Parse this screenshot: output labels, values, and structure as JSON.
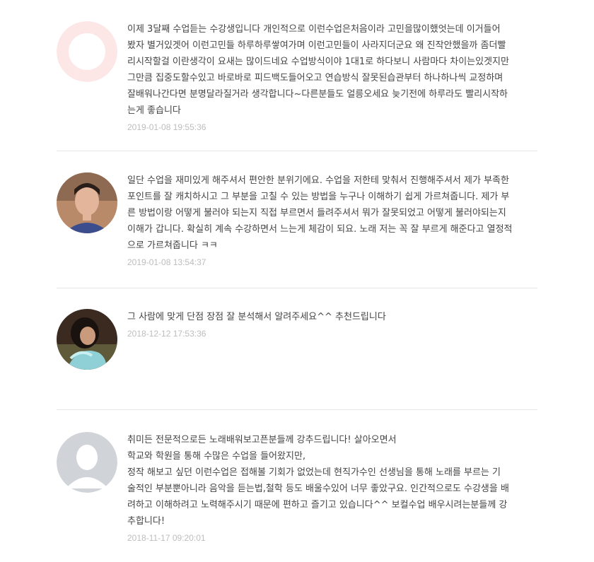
{
  "reviews": [
    {
      "avatar": "default-avatar-pink-icon",
      "lines": [
        "이제 3달째 수업듣는 수강생입니다 개인적으로 이런수업은처음이라 고민을많이했엇는데 이거들어",
        "봤자 별거있겟어 이런고민들 하루하루쌓여가며 이런고민들이 사라지더군요 왜 진작안했을까 좀더빨",
        "리시작할걸 이란생각이 요새는 많이드네요 수업방식이야 1대1로 하다보니 사람마다 차이는있겟지만",
        "그만큼 집중도할수있고 바로바로 피드백도들어오고 연습방식 잘못된습관부터 하나하나씩 교정하며",
        "잘배워나간다면 분명달라질거라 생각합니다~다른분들도 얼릉오세요 늦기전에 하루라도 빨리시작하",
        "는게 좋습니다"
      ],
      "date": "2019-01-08 19:55:36"
    },
    {
      "avatar": "user-photo-young-man",
      "lines": [
        "일단 수업을 재미있게 해주셔서 편안한 분위기에요. 수업을 저한테 맞춰서 진행해주셔서 제가 부족한",
        "포인트를 잘 캐치하시고 그 부분을 고칠 수 있는 방법을 누구나 이해하기 쉽게 가르쳐줍니다. 제가 부",
        "른 방법이랑 어떻게 불러야 되는지 직접 부르면서 들려주셔서 뭐가 잘못되었고 어떻게 불러야되는지",
        "이해가 갑니다. 확실히 계속 수강하면서 느는게 체감이 되요. 노래 저는 꼭 잘 부르게 해준다고 열정적",
        "으로 가르쳐줍니다 ㅋㅋ"
      ],
      "date": "2019-01-08 13:54:37"
    },
    {
      "avatar": "user-photo-woman",
      "lines": [
        "그 사람에 맞게 단점 장점 잘 분석해서 알려주세요^^ 추천드립니다"
      ],
      "date": "2018-12-12 17:53:36"
    },
    {
      "avatar": "default-avatar-gray-icon",
      "lines": [
        "취미든 전문적으로든 노래배워보고픈분들께 강추드립니다! 살아오면서",
        "학교와 학원을 통해 수많은 수업을 들어왔지만,",
        "정작 해보고 싶던 이런수업은 접해볼 기회가 없었는데 현직가수인 선생님을 통해 노래를 부르는 기",
        "술적인 부분뿐아니라 음악을 듣는법,철학 등도 배울수있어 너무 좋았구요. 인간적으로도 수강생을 배",
        "려하고 이해하려고 노력해주시기 때문에 편하고 즐기고 있습니다^^ 보컬수업 배우시려는분들께 강",
        "추합니다!"
      ],
      "date": "2018-11-17 09:20:01"
    }
  ],
  "colors": {
    "text": "#444444",
    "date": "#bdbdbd",
    "divider": "#e5e5e5",
    "avatar_pink": "#fde3e3",
    "avatar_gray": "#d0d3d8"
  }
}
